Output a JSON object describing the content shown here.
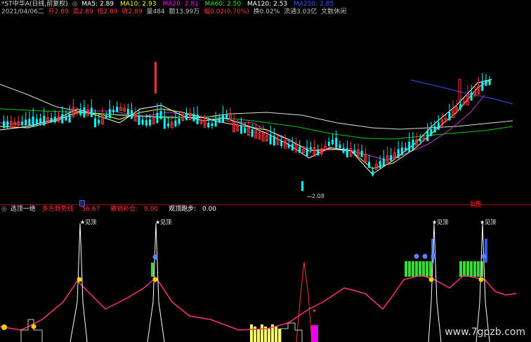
{
  "header": {
    "title": "*ST中华A(日线,前复权)",
    "ma": [
      {
        "label": "MA5:",
        "value": "2.89",
        "color": "#ffffff"
      },
      {
        "label": "MA10:",
        "value": "2.93",
        "color": "#ffff00"
      },
      {
        "label": "MA20:",
        "value": "2.81",
        "color": "#ff00ff"
      },
      {
        "label": "MA60:",
        "value": "2.50",
        "color": "#00ff00"
      },
      {
        "label": "MA120:",
        "value": "2.53",
        "color": "#ffffff"
      },
      {
        "label": "MA250:",
        "value": "2.85",
        "color": "#3355ff"
      }
    ],
    "quote": [
      {
        "text": "2021/04/06二",
        "color": "#c0c0c0"
      },
      {
        "text": "开2.89",
        "color": "#ff3333"
      },
      {
        "text": "高2.89",
        "color": "#ff3333"
      },
      {
        "text": "低2.89",
        "color": "#ff3333"
      },
      {
        "text": "收2.89",
        "color": "#ff3333"
      },
      {
        "text": "量484",
        "color": "#c0c0c0"
      },
      {
        "text": "额13.99万",
        "color": "#c0c0c0"
      },
      {
        "text": "幅0.02(0.70%)",
        "color": "#ff3333"
      },
      {
        "text": "换0.02%",
        "color": "#c0c0c0"
      },
      {
        "text": "流通3.03亿",
        "color": "#c0c0c0"
      },
      {
        "text": "文数休闲",
        "color": "#c0c0c0"
      }
    ]
  },
  "price_chart": {
    "low_label": "2.08",
    "corner_tag": "公告"
  },
  "indicator": {
    "name": "选顶一绝",
    "fields": [
      {
        "label": "多方趋势线:",
        "value": "56.67",
        "color": "#ff3333"
      },
      {
        "label": "撤销补仓:",
        "value": "0.00",
        "color": "#ff3333"
      },
      {
        "label": "观顶跑步:",
        "value": "0.00",
        "color": "#ffffff"
      }
    ],
    "signal_label": "★见顶",
    "signal_count": 4
  },
  "watermark": "www.7gpzb.com",
  "colors": {
    "up": "#ff3333",
    "down": "#00ffff",
    "accent": "#ff00ff"
  }
}
